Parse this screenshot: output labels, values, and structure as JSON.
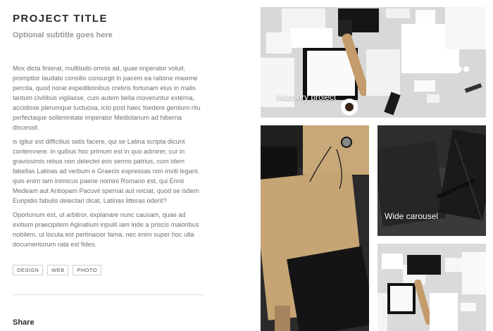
{
  "project": {
    "title": "PROJECT TITLE",
    "subtitle": "Optional subtitle goes here"
  },
  "paragraphs": [
    "Mox dicta finierat, multitudo omnis ad, quae imperator voluit, promptior laudato consilio consurgit in pacem ea ratione maxime percita, quod norat expeditionibus crebris fortunam eius in malis tantum civilibus vigilasse, cum autem bella moveruntur externa, accidisse plerumque luctuosa, icto post haec foedere gentium ritu perfectaque sollemnitate imperator Mediolanum ad hiberna discessit.",
    "is igitur est difficilius satis facere, qui se Latina scripta dicunt contemnere. in quibus hoc primum est in quo admirer, cur in gravissimis rebus non delectet eos sermo patrius, cum idem fabellas Latinas ad verbum e Graecis expressas non inviti legant. quis enim tam inimicus paene nomini Romano est, qui Ennii Medeam aut Antiopam Pacuvii spernat aut reiciat, quod se isdem Euripidis fabulis delectari dicat, Latinas litteras oderit?",
    "Oportunum est, ut arbitror, explanare nunc causam, quae ad exitium praecipitem Aginatium inpulit iam inde a priscis maioribus nobilem, ut locuta est pertinacior fama. nec enim super hoc ulla documentorum rata est fides."
  ],
  "tags": [
    "DESIGN",
    "WEB",
    "PHOTO"
  ],
  "share_label": "Share",
  "tiles": {
    "masonry_label": "Masonry project",
    "carousel_label": "Wide carousel"
  }
}
